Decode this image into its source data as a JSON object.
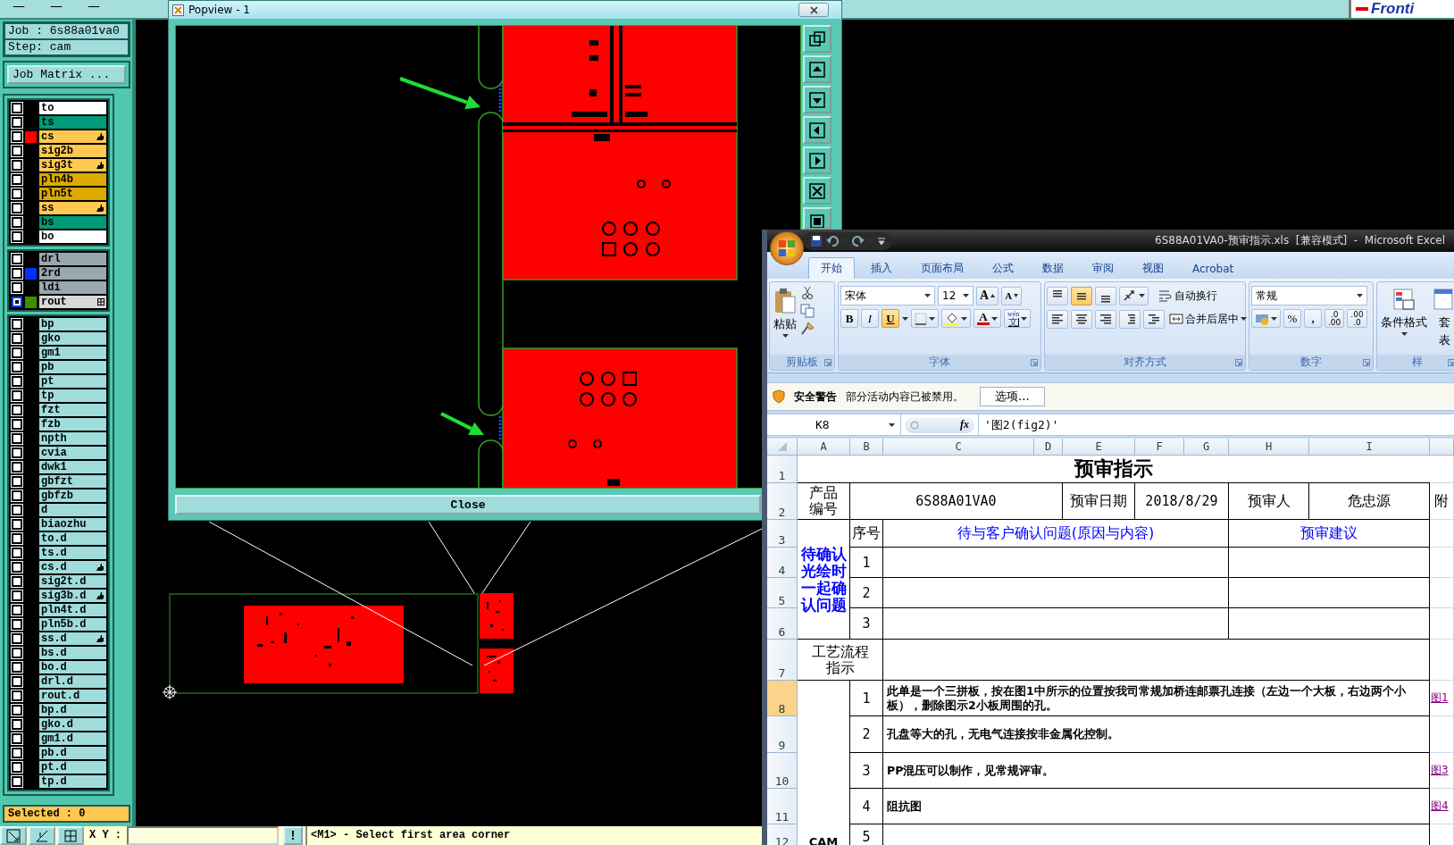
{
  "cam": {
    "window_buttons": [
      "—",
      "—",
      "—"
    ],
    "logo": "Fronti",
    "job": "Job : 6s88a01va0",
    "step": "Step: cam",
    "job_matrix_button": "Job Matrix ...",
    "layer_groups": [
      [
        {
          "name": "to",
          "color": "#ffffff",
          "marked": false,
          "menu": false,
          "selected": false
        },
        {
          "name": "ts",
          "color": "#009a78",
          "marked": false,
          "menu": false,
          "selected": false
        },
        {
          "name": "cs",
          "color": "#ffc850",
          "swatch": {
            "color": "#ff0000"
          },
          "marked": true,
          "menu": false,
          "selected": false
        },
        {
          "name": "sig2b",
          "color": "#ffc850",
          "marked": false,
          "menu": false,
          "selected": false
        },
        {
          "name": "sig3t",
          "color": "#ffc850",
          "marked": true,
          "menu": false,
          "selected": false
        },
        {
          "name": "pln4b",
          "color": "#dcaa00",
          "marked": false,
          "menu": false,
          "selected": false
        },
        {
          "name": "pln5t",
          "color": "#dcaa00",
          "marked": false,
          "menu": false,
          "selected": false
        },
        {
          "name": "ss",
          "color": "#ffc850",
          "marked": true,
          "menu": false,
          "selected": false
        },
        {
          "name": "bs",
          "color": "#009a78",
          "marked": false,
          "menu": false,
          "selected": false
        },
        {
          "name": "bo",
          "color": "#ffffff",
          "marked": false,
          "menu": false,
          "selected": false
        }
      ],
      [
        {
          "name": "drl",
          "color": "#98a8b0",
          "marked": false,
          "menu": false,
          "selected": false
        },
        {
          "name": "2rd",
          "color": "#98a8b0",
          "swatch": {
            "color": "#0030ff"
          },
          "marked": false,
          "menu": false,
          "selected": false
        },
        {
          "name": "ldi",
          "color": "#98a8b0",
          "marked": false,
          "menu": false,
          "selected": false
        },
        {
          "name": "rout",
          "color": "#d8d8d8",
          "swatch": {
            "color": "#3a9000"
          },
          "marked": false,
          "menu": true,
          "selected": true
        }
      ],
      [
        {
          "name": "bp",
          "color": "#a0dcdc",
          "marked": false,
          "menu": false,
          "selected": false
        },
        {
          "name": "gko",
          "color": "#a0dcdc",
          "marked": false,
          "menu": false,
          "selected": false
        },
        {
          "name": "gm1",
          "color": "#a0dcdc",
          "marked": false,
          "menu": false,
          "selected": false
        },
        {
          "name": "pb",
          "color": "#a0dcdc",
          "marked": false,
          "menu": false,
          "selected": false
        },
        {
          "name": "pt",
          "color": "#a0dcdc",
          "marked": false,
          "menu": false,
          "selected": false
        },
        {
          "name": "tp",
          "color": "#a0dcdc",
          "marked": false,
          "menu": false,
          "selected": false
        },
        {
          "name": "fzt",
          "color": "#a0dcdc",
          "marked": false,
          "menu": false,
          "selected": false
        },
        {
          "name": "fzb",
          "color": "#a0dcdc",
          "marked": false,
          "menu": false,
          "selected": false
        },
        {
          "name": "npth",
          "color": "#a0dcdc",
          "marked": false,
          "menu": false,
          "selected": false
        },
        {
          "name": "cvia",
          "color": "#a0dcdc",
          "marked": false,
          "menu": false,
          "selected": false
        },
        {
          "name": "dwk1",
          "color": "#a0dcdc",
          "marked": false,
          "menu": false,
          "selected": false
        },
        {
          "name": "gbfzt",
          "color": "#a0dcdc",
          "marked": false,
          "menu": false,
          "selected": false
        },
        {
          "name": "gbfzb",
          "color": "#a0dcdc",
          "marked": false,
          "menu": false,
          "selected": false
        },
        {
          "name": "d",
          "color": "#a0dcdc",
          "marked": false,
          "menu": false,
          "selected": false
        },
        {
          "name": "biaozhu",
          "color": "#a0dcdc",
          "marked": false,
          "menu": false,
          "selected": false
        },
        {
          "name": "to.d",
          "color": "#a0dcdc",
          "marked": false,
          "menu": false,
          "selected": false
        },
        {
          "name": "ts.d",
          "color": "#a0dcdc",
          "marked": false,
          "menu": false,
          "selected": false
        },
        {
          "name": "cs.d",
          "color": "#a0dcdc",
          "marked": true,
          "menu": false,
          "selected": false
        },
        {
          "name": "sig2t.d",
          "color": "#a0dcdc",
          "marked": false,
          "menu": false,
          "selected": false
        },
        {
          "name": "sig3b.d",
          "color": "#a0dcdc",
          "marked": true,
          "menu": false,
          "selected": false
        },
        {
          "name": "pln4t.d",
          "color": "#a0dcdc",
          "marked": false,
          "menu": false,
          "selected": false
        },
        {
          "name": "pln5b.d",
          "color": "#a0dcdc",
          "marked": false,
          "menu": false,
          "selected": false
        },
        {
          "name": "ss.d",
          "color": "#a0dcdc",
          "marked": true,
          "menu": false,
          "selected": false
        },
        {
          "name": "bs.d",
          "color": "#a0dcdc",
          "marked": false,
          "menu": false,
          "selected": false
        },
        {
          "name": "bo.d",
          "color": "#a0dcdc",
          "marked": false,
          "menu": false,
          "selected": false
        },
        {
          "name": "drl.d",
          "color": "#a0dcdc",
          "marked": false,
          "menu": false,
          "selected": false
        },
        {
          "name": "rout.d",
          "color": "#a0dcdc",
          "marked": false,
          "menu": false,
          "selected": false
        },
        {
          "name": "bp.d",
          "color": "#a0dcdc",
          "marked": false,
          "menu": false,
          "selected": false
        },
        {
          "name": "gko.d",
          "color": "#a0dcdc",
          "marked": false,
          "menu": false,
          "selected": false
        },
        {
          "name": "gm1.d",
          "color": "#a0dcdc",
          "marked": false,
          "menu": false,
          "selected": false
        },
        {
          "name": "pb.d",
          "color": "#a0dcdc",
          "marked": false,
          "menu": false,
          "selected": false
        },
        {
          "name": "pt.d",
          "color": "#a0dcdc",
          "marked": false,
          "menu": false,
          "selected": false
        },
        {
          "name": "tp.d",
          "color": "#a0dcdc",
          "marked": false,
          "menu": false,
          "selected": false
        }
      ]
    ],
    "selected_count": "Selected : 0",
    "xy_label": "X Y :",
    "alert_button": "!",
    "message": "<M1> - Select first area corner"
  },
  "popview": {
    "title": "Popview - 1",
    "close_button": "Close"
  },
  "excel": {
    "title": "6S88A01VA0-预审指示.xls  [兼容模式]  -  Microsoft Excel",
    "tabs": [
      {
        "label": "开始",
        "selected": true
      },
      {
        "label": "插入",
        "selected": false
      },
      {
        "label": "页面布局",
        "selected": false
      },
      {
        "label": "公式",
        "selected": false
      },
      {
        "label": "数据",
        "selected": false
      },
      {
        "label": "审阅",
        "selected": false
      },
      {
        "label": "视图",
        "selected": false
      },
      {
        "label": "Acrobat",
        "selected": false
      }
    ],
    "ribbon": {
      "paste": "粘贴",
      "clipboard_title": "剪贴板",
      "font_name": "宋体",
      "font_size": "12",
      "grow_font": "A",
      "shrink_font": "A",
      "bold": "B",
      "italic": "I",
      "underline": "U",
      "underline_selected": true,
      "font_color": "A",
      "phonetic": "wén",
      "phonetic_char": "文",
      "font_title": "字体",
      "middle_align_selected": true,
      "wrap_text": "自动换行",
      "merge_center": "合并后居中",
      "alignment_title": "对齐方式",
      "number_format": "常规",
      "percent": "%",
      "comma": ",",
      "increase_decimal": [
        ".0",
        ".00"
      ],
      "decrease_decimal": [
        ".00",
        ".0"
      ],
      "number_title": "数字",
      "conditional_format": "条件格式",
      "table_format": [
        "套",
        "表"
      ],
      "styles_title": "样"
    },
    "security": {
      "title": "安全警告",
      "message": "部分活动内容已被禁用。",
      "options_button": "选项..."
    },
    "formula": {
      "cell": "K8",
      "function_label": "fx",
      "value": "'图2(fig2)'"
    },
    "columns": [
      "A",
      "B",
      "C",
      "D",
      "E",
      "F",
      "G",
      "H",
      "I"
    ],
    "rows": [
      {
        "number": "1",
        "selected": false,
        "cells": [
          {
            "text": ""
          },
          {
            "text": ""
          },
          {
            "text": ""
          },
          {
            "text": ""
          },
          {
            "text": "预审指示",
            "kind": "title"
          }
        ]
      },
      {
        "number": "2",
        "selected": false,
        "cells": [
          {
            "text": "产品编号",
            "kind": "stacked"
          },
          {
            "text": "6S88A01VA0",
            "kind": "value"
          },
          {
            "text": ""
          },
          {
            "text": ""
          },
          {
            "text": "预审日期",
            "kind": "label"
          },
          {
            "text": "2018/8/29",
            "kind": "value"
          },
          {
            "text": ""
          },
          {
            "text": "预审人",
            "kind": "label"
          },
          {
            "text": "危忠源",
            "kind": "label"
          },
          {
            "text": "附",
            "kind": "label"
          }
        ]
      },
      {
        "number": "3",
        "selected": false,
        "cells": [
          {
            "text": "待确认光绘时一起确认问题",
            "kind": "group"
          },
          {
            "text": "序号",
            "kind": "label"
          },
          {
            "text": "待与客户确认问题(原因与内容)",
            "kind": "header"
          },
          {
            "text": "预审建议",
            "kind": "header"
          }
        ]
      },
      {
        "number": "4",
        "selected": false,
        "cells": [
          {
            "text": "1",
            "kind": "seq"
          }
        ]
      },
      {
        "number": "5",
        "selected": false,
        "cells": [
          {
            "text": "2",
            "kind": "seq"
          }
        ]
      },
      {
        "number": "6",
        "selected": false,
        "cells": [
          {
            "text": "3",
            "kind": "seq"
          }
        ]
      },
      {
        "number": "7",
        "selected": false,
        "cells": [
          {
            "text": "工艺流程指示",
            "kind": "stacked"
          }
        ]
      },
      {
        "number": "8",
        "selected": true,
        "cells": [
          {
            "text": "1",
            "kind": "seq"
          },
          {
            "text": "此单是一个三拼板，按在图1中所示的位置按我司常规加桥连邮票孔连接（左边一个大板，右边两个小板），删除图示2小板周围的孔。",
            "kind": "note"
          },
          {
            "text": "图1",
            "kind": "link"
          }
        ]
      },
      {
        "number": "9",
        "selected": false,
        "cells": [
          {
            "text": "2",
            "kind": "seq"
          },
          {
            "text": "孔盘等大的孔，无电气连接按非金属化控制。",
            "kind": "note"
          }
        ]
      },
      {
        "number": "10",
        "selected": false,
        "cells": [
          {
            "text": "3",
            "kind": "seq"
          },
          {
            "text": "PP混压可以制作，见常规评审。",
            "kind": "note"
          },
          {
            "text": "图3",
            "kind": "link"
          }
        ]
      },
      {
        "number": "11",
        "selected": false,
        "cells": [
          {
            "text": "4",
            "kind": "seq"
          },
          {
            "text": "阻抗图",
            "kind": "note"
          },
          {
            "text": "图4",
            "kind": "link"
          }
        ]
      },
      {
        "number": "12",
        "selected": false,
        "cells": [
          {
            "text": "CAM",
            "kind": "section"
          },
          {
            "text": "5",
            "kind": "seq"
          }
        ]
      }
    ]
  }
}
